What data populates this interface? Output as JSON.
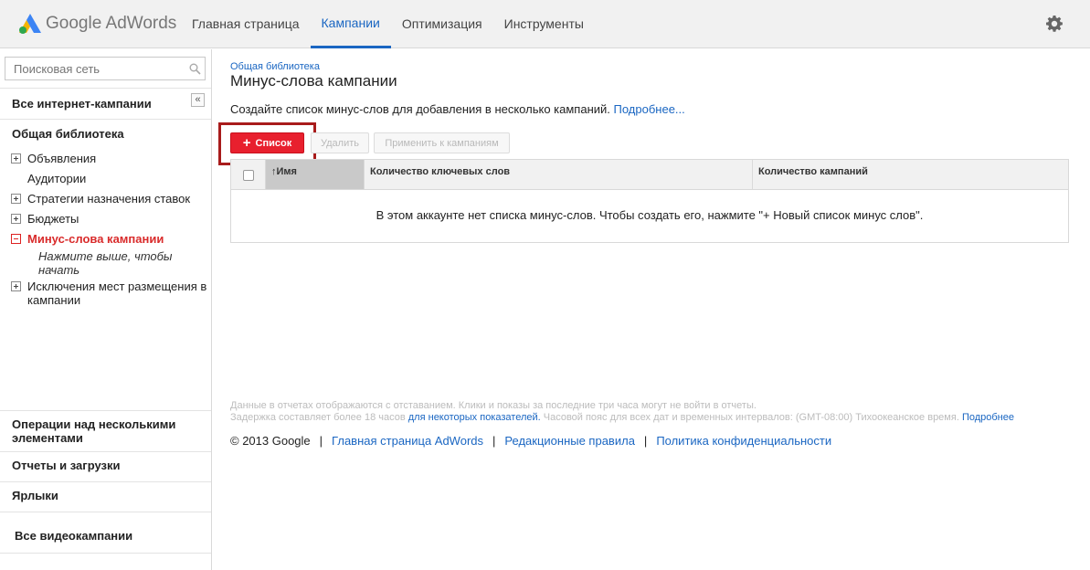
{
  "app": {
    "logo_google": "Google",
    "logo_product": "AdWords"
  },
  "nav": {
    "items": [
      {
        "label": "Главная страница"
      },
      {
        "label": "Кампании"
      },
      {
        "label": "Оптимизация"
      },
      {
        "label": "Инструменты"
      }
    ],
    "active_index": 1
  },
  "sidebar": {
    "search_placeholder": "Поисковая сеть",
    "all_campaigns": "Все интернет-кампании",
    "collapse_glyph": "«",
    "shared_library": "Общая библиотека",
    "tree": {
      "ads": "Объявления",
      "audiences": "Аудитории",
      "bid_strategies": "Стратегии назначения ставок",
      "budgets": "Бюджеты",
      "negative_keywords": "Минус-слова кампании",
      "hint_line1": "Нажмите выше, чтобы",
      "hint_line2": "начать",
      "placement_exclusions_line1": "Исключения мест размещения в",
      "placement_exclusions_line2": "кампании"
    },
    "bulk_ops_line1": "Операции над несколькими",
    "bulk_ops_line2": "элементами",
    "reports": "Отчеты и загрузки",
    "labels": "Ярлыки",
    "video_campaigns": "Все видеокампании"
  },
  "main": {
    "breadcrumb": "Общая библиотека",
    "title": "Минус-слова кампании",
    "description": "Создайте список минус-слов для добавления в несколько кампаний.",
    "learn_more": "Подробнее...",
    "buttons": {
      "add": "Список",
      "delete": "Удалить",
      "apply": "Применить к кампаниям"
    },
    "table": {
      "columns": [
        "Имя",
        "Количество ключевых слов",
        "Количество кампаний"
      ],
      "sort_indicator": "↑",
      "empty_message": "В этом аккаунте нет списка минус-слов. Чтобы создать его, нажмите \"+ Новый список минус слов\"."
    },
    "notes": {
      "line1": "Данные в отчетах отображаются с отставанием. Клики и показы за последние три часа могут не войти в отчеты.",
      "line2_a": "Задержка составляет более 18 часов",
      "line2_link": "для некоторых показателей.",
      "line2_b": "Часовой пояс для всех дат и временных интервалов: (GMT-08:00) Тихоокеанское время.",
      "line2_more": "Подробнее"
    },
    "footer": {
      "copyright": "© 2013 Google",
      "links": [
        "Главная страница AdWords",
        "Редакционные правила",
        "Политика конфиденциальности"
      ],
      "separator": "|"
    }
  },
  "colors": {
    "accent_blue": "#1a66c2",
    "add_button_red": "#e8202e",
    "highlight_box": "#a81b1b",
    "active_tree_item": "#d92b2b"
  }
}
